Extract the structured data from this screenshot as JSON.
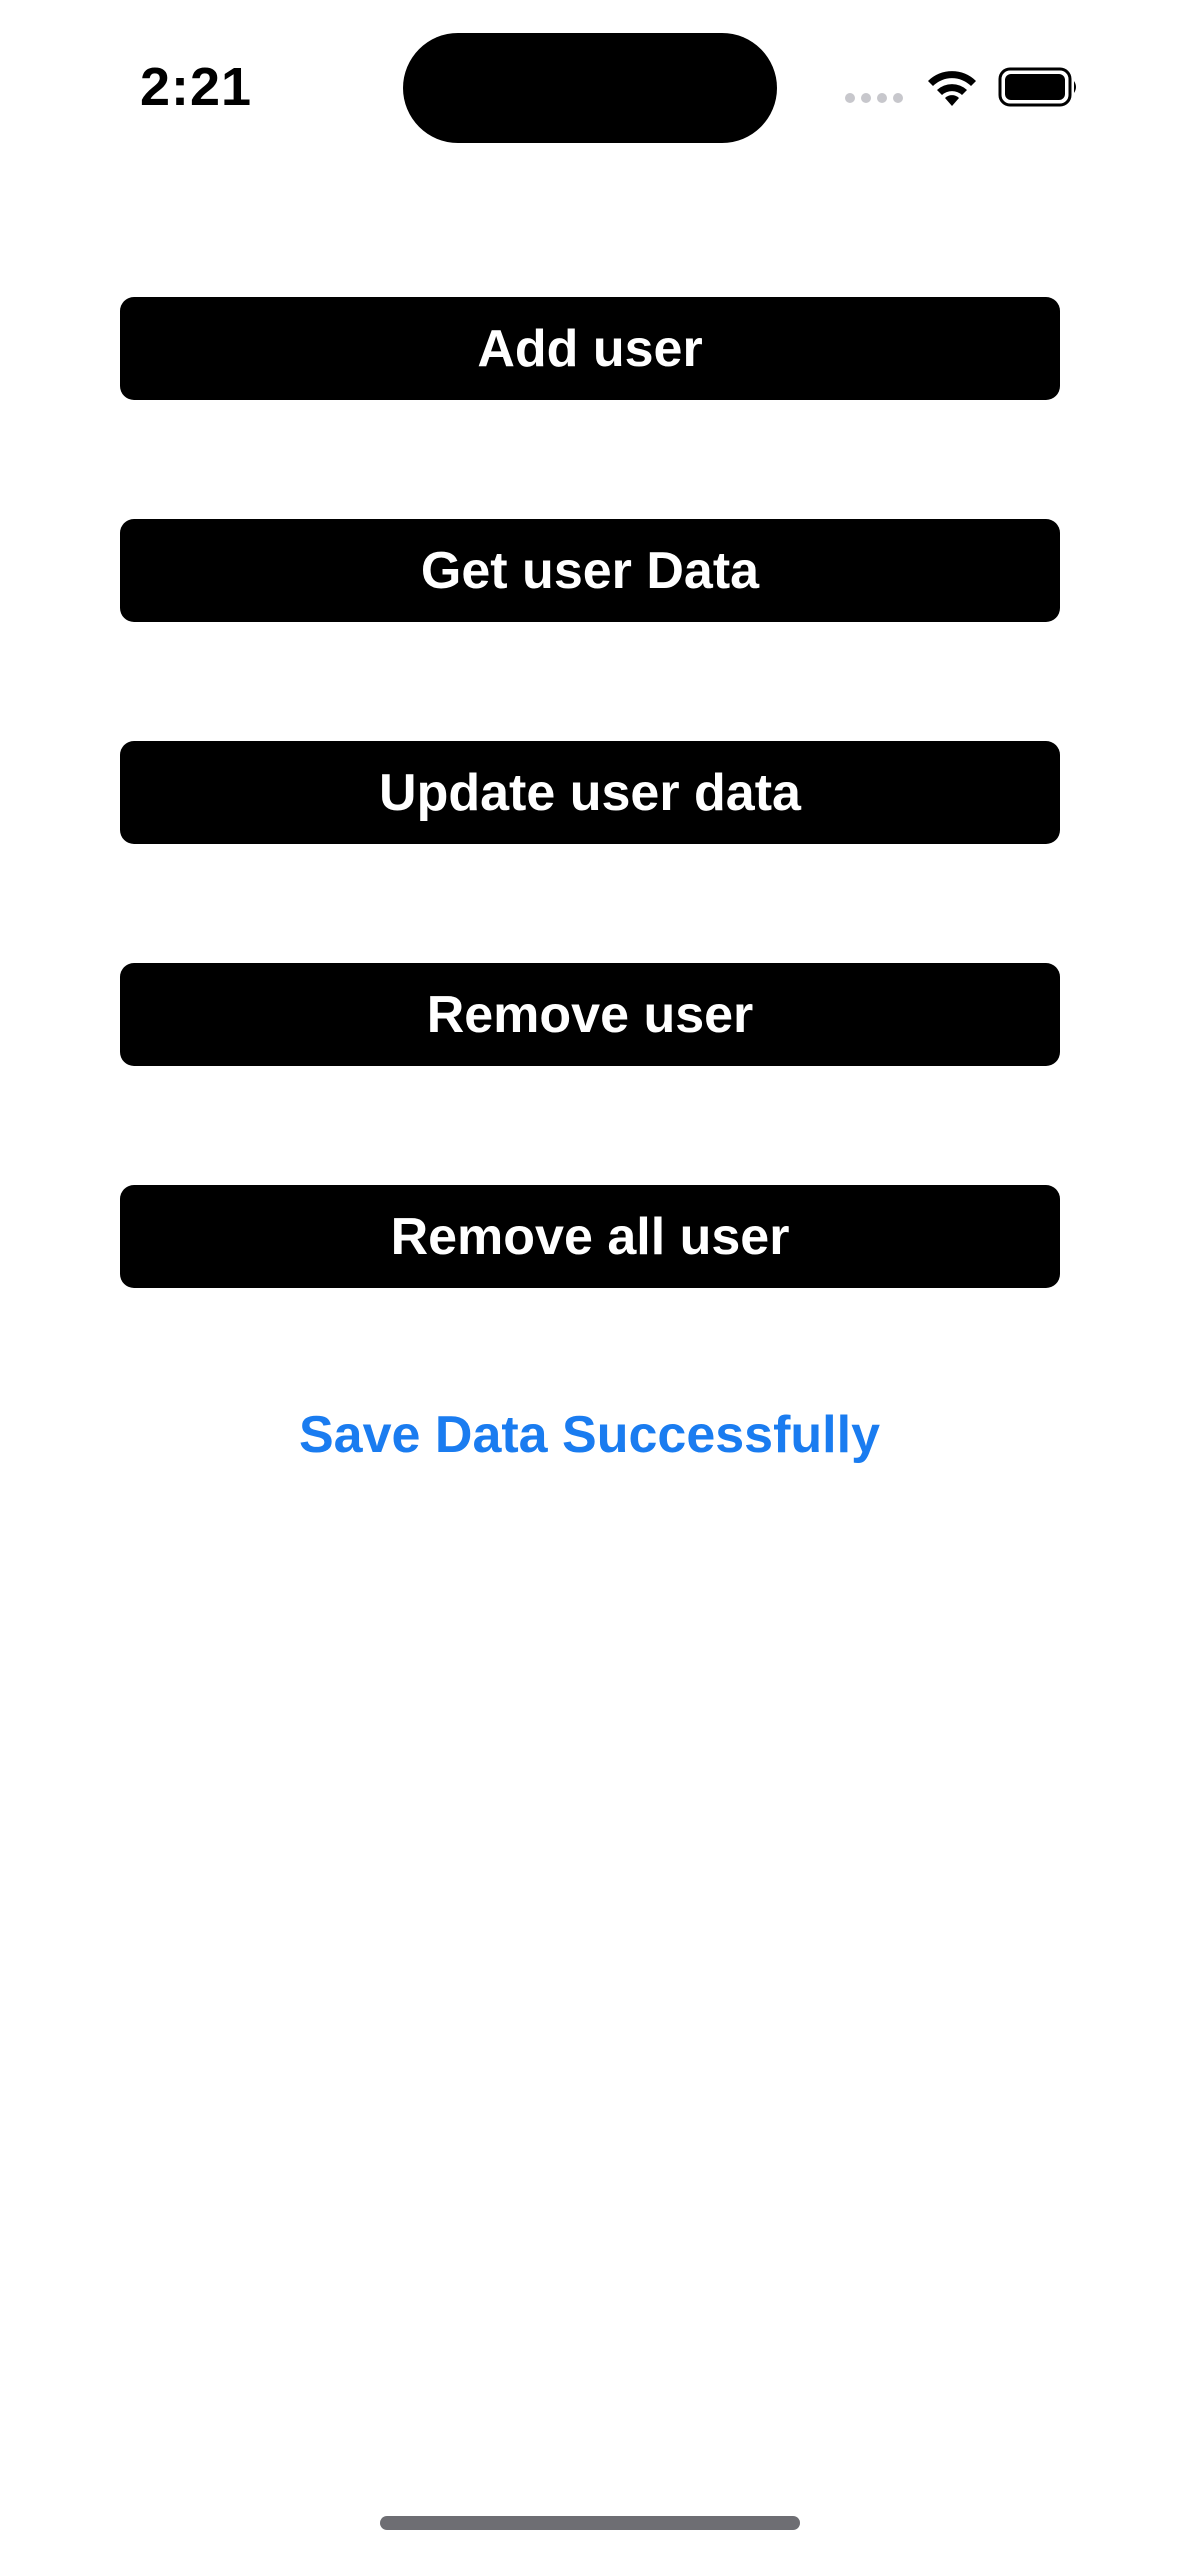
{
  "status_bar": {
    "time": "2:21",
    "icons": {
      "signal": "cell-signal-icon",
      "wifi": "wifi-icon",
      "battery": "battery-icon"
    }
  },
  "buttons": {
    "add_user": "Add user",
    "get_user_data": "Get user Data",
    "update_user_data": "Update user data",
    "remove_user": "Remove user",
    "remove_all_user": "Remove all user"
  },
  "status_message": {
    "text": "Save Data Successfully",
    "color": "#1a7cf0"
  },
  "colors": {
    "button_background": "#000000",
    "button_text": "#ffffff",
    "page_background": "#ffffff"
  }
}
